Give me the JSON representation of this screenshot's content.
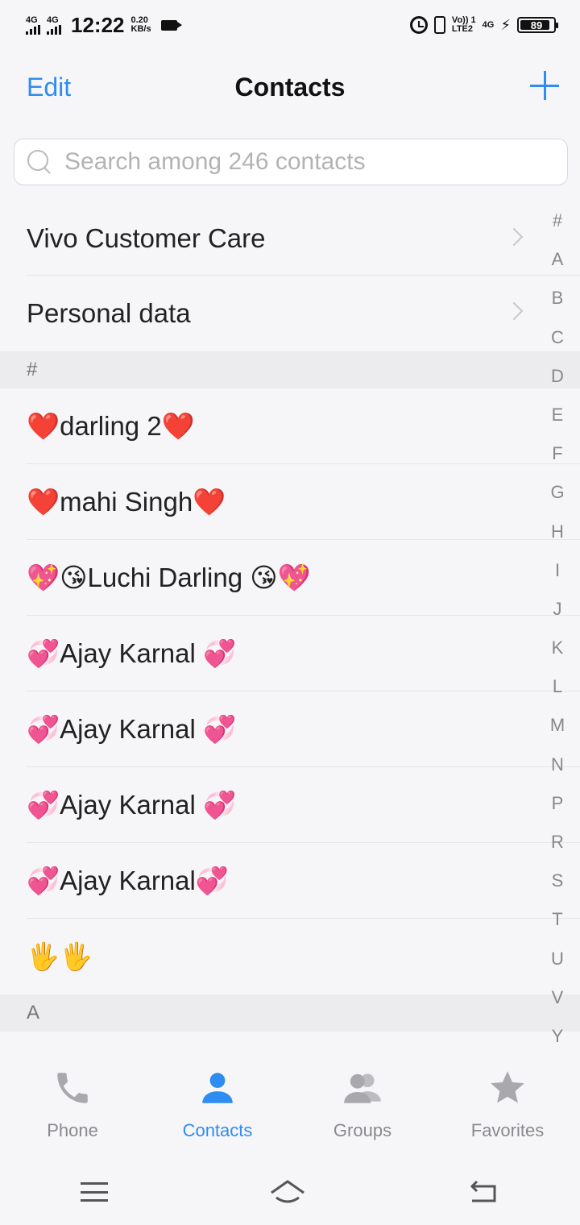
{
  "status_bar": {
    "network1": "4G",
    "network2": "4G",
    "time": "12:22",
    "speed_value": "0.20",
    "speed_unit": "KB/s",
    "volte_top": "Vo)) 1",
    "volte_bottom": "LTE2",
    "network3": "4G",
    "battery": "89",
    "battery_level": 0.89
  },
  "header": {
    "edit_label": "Edit",
    "title": "Contacts"
  },
  "search": {
    "placeholder": "Search among 246 contacts"
  },
  "top_items": [
    {
      "label": "Vivo Customer Care"
    },
    {
      "label": "Personal data"
    }
  ],
  "sections": [
    {
      "header": "#",
      "contacts": [
        "❤️darling 2❤️",
        "❤️mahi Singh❤️",
        "💖😘Luchi Darling 😘💖",
        "💞Ajay Karnal 💞",
        "💞Ajay Karnal 💞",
        "💞Ajay Karnal 💞",
        "💞Ajay Karnal💞",
        "🖐🖐"
      ]
    },
    {
      "header": "A",
      "contacts": []
    }
  ],
  "alpha_index": [
    "#",
    "A",
    "B",
    "C",
    "D",
    "E",
    "F",
    "G",
    "H",
    "I",
    "J",
    "K",
    "L",
    "M",
    "N",
    "P",
    "R",
    "S",
    "T",
    "U",
    "V",
    "Y"
  ],
  "tabs": [
    {
      "label": "Phone",
      "icon": "phone-icon"
    },
    {
      "label": "Contacts",
      "icon": "person-icon"
    },
    {
      "label": "Groups",
      "icon": "group-icon"
    },
    {
      "label": "Favorites",
      "icon": "star-icon"
    }
  ],
  "colors": {
    "accent": "#2f8cf0",
    "background": "#f6f6f8",
    "section_bg": "#ececef"
  }
}
